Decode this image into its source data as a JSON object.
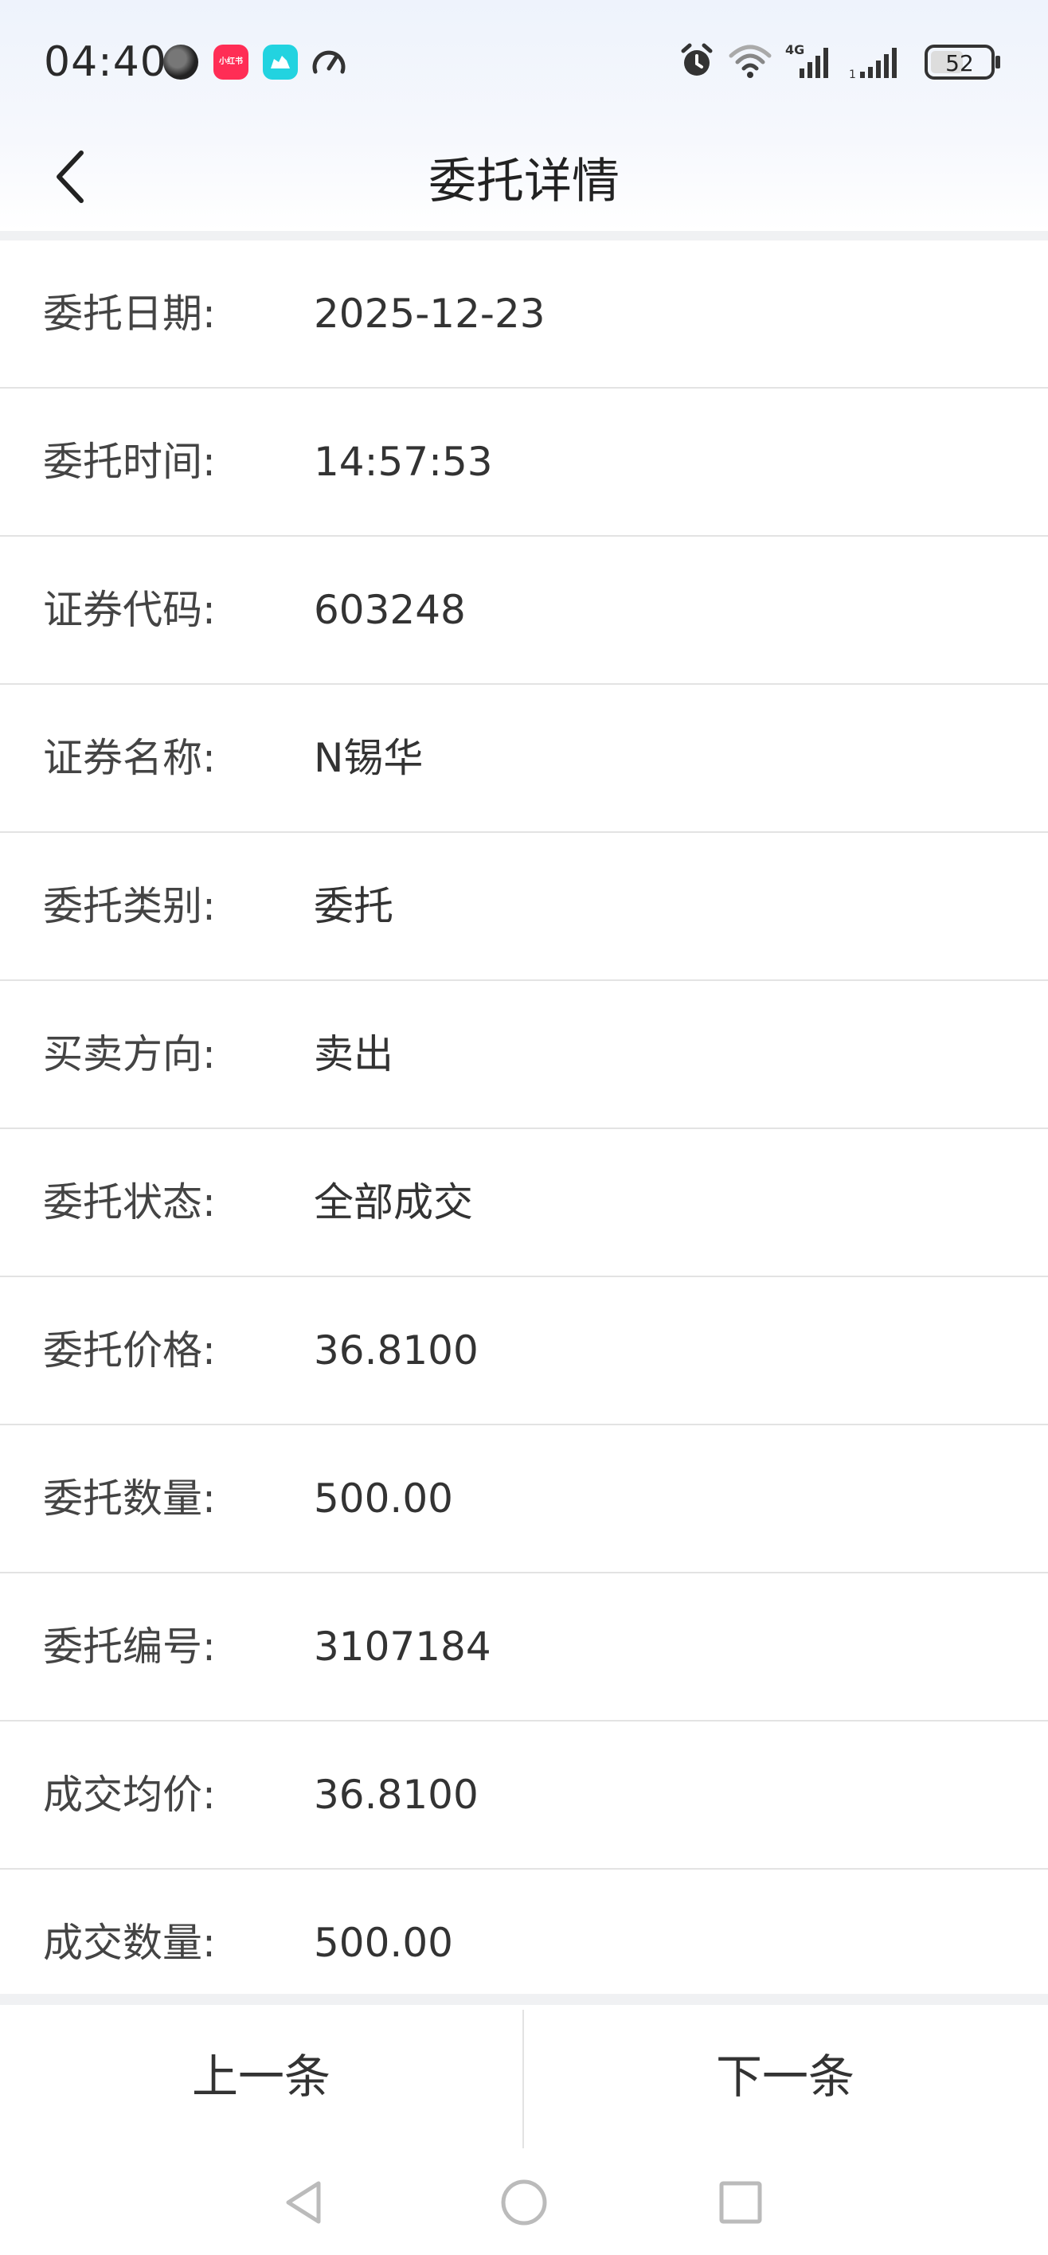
{
  "status_bar": {
    "time": "04:40",
    "network": "4G",
    "battery": "52",
    "app_icon_badge": "小红书"
  },
  "nav": {
    "title": "委托详情"
  },
  "details": [
    {
      "label": "委托日期:",
      "value": "2025-12-23"
    },
    {
      "label": "委托时间:",
      "value": "14:57:53"
    },
    {
      "label": "证券代码:",
      "value": "603248"
    },
    {
      "label": "证券名称:",
      "value": "N锡华"
    },
    {
      "label": "委托类别:",
      "value": "委托"
    },
    {
      "label": "买卖方向:",
      "value": "卖出"
    },
    {
      "label": "委托状态:",
      "value": "全部成交"
    },
    {
      "label": "委托价格:",
      "value": "36.8100"
    },
    {
      "label": "委托数量:",
      "value": "500.00"
    },
    {
      "label": "委托编号:",
      "value": "3107184"
    },
    {
      "label": "成交均价:",
      "value": "36.8100"
    },
    {
      "label": "成交数量:",
      "value": "500.00"
    }
  ],
  "buttons": {
    "prev": "上一条",
    "next": "下一条"
  }
}
